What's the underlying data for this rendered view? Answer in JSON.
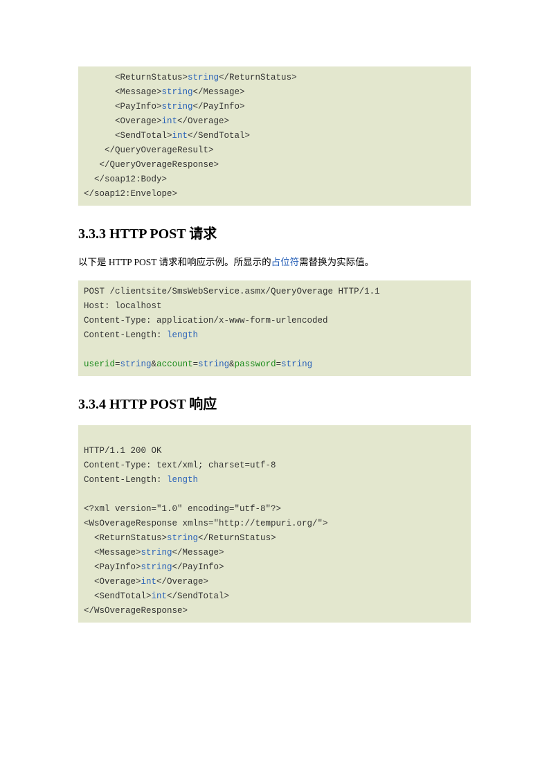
{
  "code1": {
    "lines": [
      {
        "pre": "      <ReturnStatus>",
        "ph": "string",
        "post": "</ReturnStatus>"
      },
      {
        "pre": "      <Message>",
        "ph": "string",
        "post": "</Message>"
      },
      {
        "pre": "      <PayInfo>",
        "ph": "string",
        "post": "</PayInfo>"
      },
      {
        "pre": "      <Overage>",
        "ph": "int",
        "post": "</Overage>"
      },
      {
        "pre": "      <SendTotal>",
        "ph": "int",
        "post": "</SendTotal>"
      },
      {
        "pre": "    </QueryOverageResult>",
        "ph": "",
        "post": ""
      },
      {
        "pre": "   </QueryOverageResponse>",
        "ph": "",
        "post": ""
      },
      {
        "pre": "  </soap12:Body>",
        "ph": "",
        "post": ""
      },
      {
        "pre": "</soap12:Envelope>",
        "ph": "",
        "post": ""
      }
    ]
  },
  "heading1": "3.3.3  HTTP POST 请求",
  "desc1": {
    "pre": "以下是 HTTP POST  请求和响应示例。所显示的",
    "link": "占位符",
    "post": "需替换为实际值。"
  },
  "code2": {
    "header": [
      "POST /clientsite/SmsWebService.asmx/QueryOverage HTTP/1.1",
      "Host: localhost",
      "Content-Type: application/x-www-form-urlencoded"
    ],
    "clen_label": "Content-Length: ",
    "clen_val": "length",
    "body": {
      "p1": "userid",
      "v1": "string",
      "p2": "account",
      "v2": "string",
      "p3": "password",
      "v3": "string"
    }
  },
  "heading2": "3.3.4  HTTP POST 响应",
  "code3": {
    "header": [
      "",
      "HTTP/1.1 200 OK",
      "Content-Type: text/xml; charset=utf-8"
    ],
    "clen_label": "Content-Length: ",
    "clen_val": "length",
    "xmlhead": [
      "",
      "<?xml version=\"1.0\" encoding=\"utf-8\"?>",
      "<WsOverageResponse xmlns=\"http://tempuri.org/\">"
    ],
    "lines": [
      {
        "pre": "  <ReturnStatus>",
        "ph": "string",
        "post": "</ReturnStatus>"
      },
      {
        "pre": "  <Message>",
        "ph": "string",
        "post": "</Message>"
      },
      {
        "pre": "  <PayInfo>",
        "ph": "string",
        "post": "</PayInfo>"
      },
      {
        "pre": "  <Overage>",
        "ph": "int",
        "post": "</Overage>"
      },
      {
        "pre": "  <SendTotal>",
        "ph": "int",
        "post": "</SendTotal>"
      }
    ],
    "close": "</WsOverageResponse>"
  }
}
